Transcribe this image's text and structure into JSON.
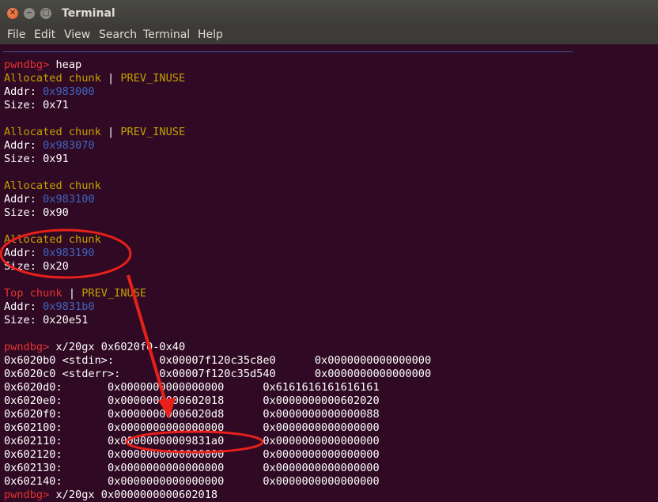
{
  "window": {
    "title": "Terminal"
  },
  "menu": [
    "File",
    "Edit",
    "View",
    "Search",
    "Terminal",
    "Help"
  ],
  "prompt": "pwndbg>",
  "heap_cmd": "heap",
  "chunks": [
    {
      "status": "Allocated chunk",
      "sep": " | ",
      "flag": "PREV_INUSE",
      "addr_label": "Addr: ",
      "addr": "0x983000",
      "size": "Size: 0x71"
    },
    {
      "status": "Allocated chunk",
      "sep": " | ",
      "flag": "PREV_INUSE",
      "addr_label": "Addr: ",
      "addr": "0x983070",
      "size": "Size: 0x91"
    },
    {
      "status": "Allocated chunk",
      "sep": "",
      "flag": "",
      "addr_label": "Addr: ",
      "addr": "0x983100",
      "size": "Size: 0x90"
    },
    {
      "status": "Allocated chunk",
      "sep": "",
      "flag": "",
      "addr_label": "Addr: ",
      "addr": "0x983190",
      "size": "Size: 0x20"
    },
    {
      "status": "Top chunk",
      "sep": " | ",
      "flag": "PREV_INUSE",
      "addr_label": "Addr: ",
      "addr": "0x9831b0",
      "size": "Size: 0x20e51"
    }
  ],
  "x_cmd": "x/20gx 0x6020f0-0x40",
  "memory_rows": [
    "0x6020b0 <stdin>:       0x00007f120c35c8e0      0x0000000000000000",
    "0x6020c0 <stderr>:      0x00007f120c35d540      0x0000000000000000",
    "0x6020d0:       0x0000000000000000      0x6161616161616161",
    "0x6020e0:       0x0000000000602018      0x0000000000602020",
    "0x6020f0:       0x00000000006020d8      0x0000000000000088",
    "0x602100:       0x0000000000000000      0x0000000000000000",
    "0x602110:       0x00000000009831a0      0x0000000000000000",
    "0x602120:       0x0000000000000000      0x0000000000000000",
    "0x602130:       0x0000000000000000      0x0000000000000000",
    "0x602140:       0x0000000000000000      0x0000000000000000"
  ],
  "last_cmd": "x/20gx 0x0000000000602018",
  "colors": {
    "background": "#300a24",
    "prompt": "#e53232",
    "chunk_label": "#c4a000",
    "address": "#3f65c2",
    "top_chunk": "#e53232",
    "annotation": "#e8201a"
  }
}
